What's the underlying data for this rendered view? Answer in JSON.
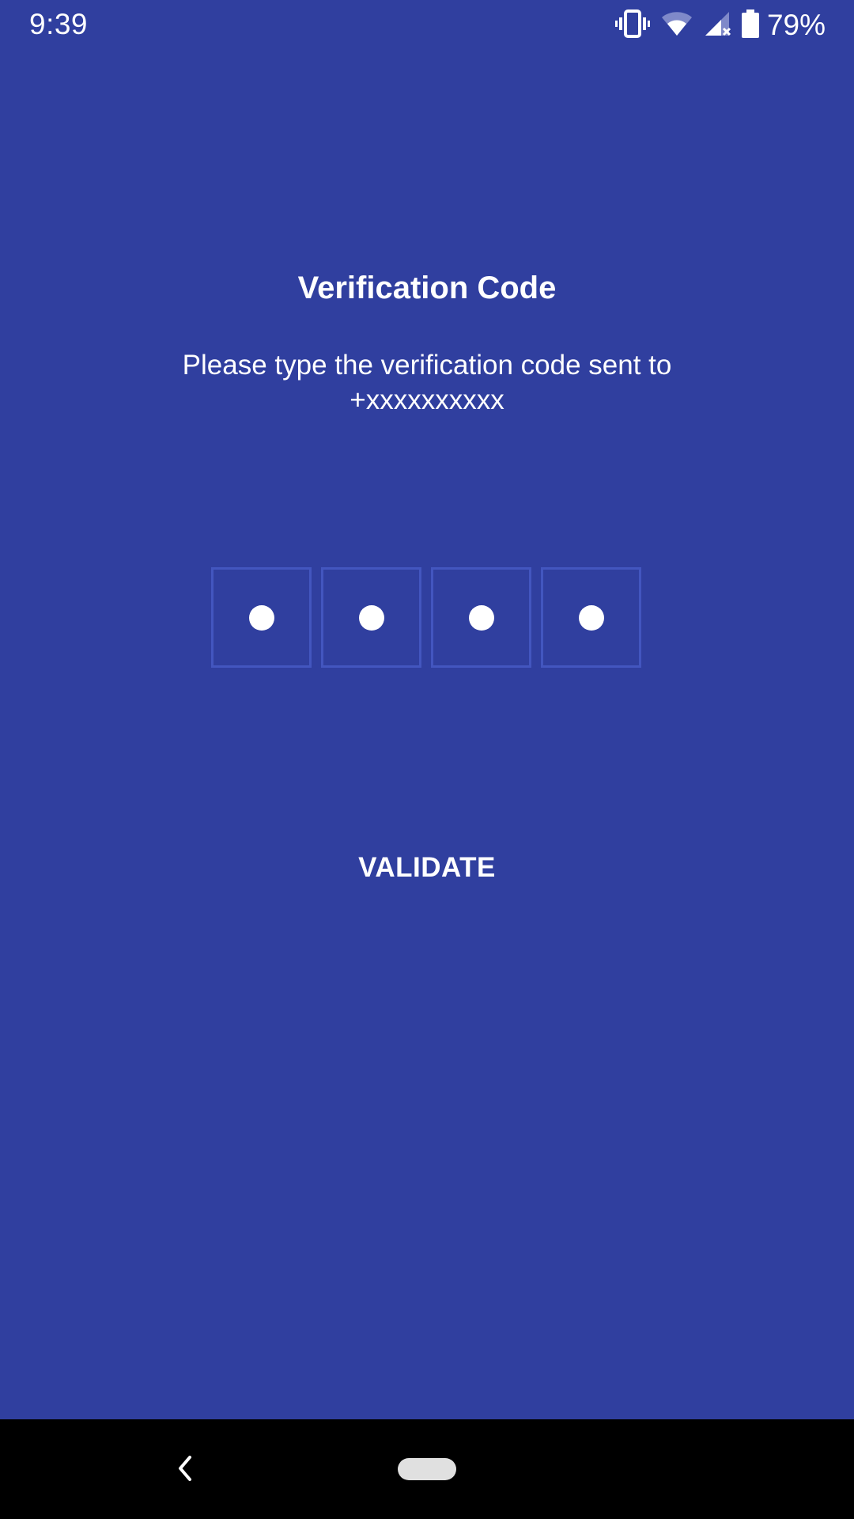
{
  "status_bar": {
    "time": "9:39",
    "battery_percent": "79%",
    "icons": [
      "vibrate-icon",
      "wifi-icon",
      "signal-icon",
      "battery-icon"
    ]
  },
  "verification": {
    "title": "Verification Code",
    "message_line1": "Please type the verification code sent to",
    "message_line2": "+xxxxxxxxxx",
    "code_length": 4,
    "entered_digits": 4
  },
  "actions": {
    "validate_label": "VALIDATE"
  },
  "nav_bar": {
    "icons": [
      "back-icon",
      "home-pill-icon"
    ]
  },
  "colors": {
    "background": "#303f9f",
    "box_border": "#4356bf",
    "text": "#ffffff",
    "nav_bar": "#000000"
  }
}
